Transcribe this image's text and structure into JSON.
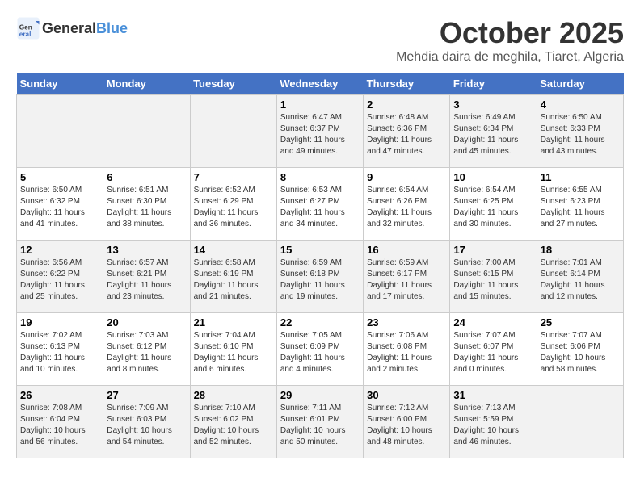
{
  "header": {
    "logo_general": "General",
    "logo_blue": "Blue",
    "month": "October 2025",
    "location": "Mehdia daira de meghila, Tiaret, Algeria"
  },
  "weekdays": [
    "Sunday",
    "Monday",
    "Tuesday",
    "Wednesday",
    "Thursday",
    "Friday",
    "Saturday"
  ],
  "weeks": [
    [
      {
        "day": "",
        "info": ""
      },
      {
        "day": "",
        "info": ""
      },
      {
        "day": "",
        "info": ""
      },
      {
        "day": "1",
        "info": "Sunrise: 6:47 AM\nSunset: 6:37 PM\nDaylight: 11 hours and 49 minutes."
      },
      {
        "day": "2",
        "info": "Sunrise: 6:48 AM\nSunset: 6:36 PM\nDaylight: 11 hours and 47 minutes."
      },
      {
        "day": "3",
        "info": "Sunrise: 6:49 AM\nSunset: 6:34 PM\nDaylight: 11 hours and 45 minutes."
      },
      {
        "day": "4",
        "info": "Sunrise: 6:50 AM\nSunset: 6:33 PM\nDaylight: 11 hours and 43 minutes."
      }
    ],
    [
      {
        "day": "5",
        "info": "Sunrise: 6:50 AM\nSunset: 6:32 PM\nDaylight: 11 hours and 41 minutes."
      },
      {
        "day": "6",
        "info": "Sunrise: 6:51 AM\nSunset: 6:30 PM\nDaylight: 11 hours and 38 minutes."
      },
      {
        "day": "7",
        "info": "Sunrise: 6:52 AM\nSunset: 6:29 PM\nDaylight: 11 hours and 36 minutes."
      },
      {
        "day": "8",
        "info": "Sunrise: 6:53 AM\nSunset: 6:27 PM\nDaylight: 11 hours and 34 minutes."
      },
      {
        "day": "9",
        "info": "Sunrise: 6:54 AM\nSunset: 6:26 PM\nDaylight: 11 hours and 32 minutes."
      },
      {
        "day": "10",
        "info": "Sunrise: 6:54 AM\nSunset: 6:25 PM\nDaylight: 11 hours and 30 minutes."
      },
      {
        "day": "11",
        "info": "Sunrise: 6:55 AM\nSunset: 6:23 PM\nDaylight: 11 hours and 27 minutes."
      }
    ],
    [
      {
        "day": "12",
        "info": "Sunrise: 6:56 AM\nSunset: 6:22 PM\nDaylight: 11 hours and 25 minutes."
      },
      {
        "day": "13",
        "info": "Sunrise: 6:57 AM\nSunset: 6:21 PM\nDaylight: 11 hours and 23 minutes."
      },
      {
        "day": "14",
        "info": "Sunrise: 6:58 AM\nSunset: 6:19 PM\nDaylight: 11 hours and 21 minutes."
      },
      {
        "day": "15",
        "info": "Sunrise: 6:59 AM\nSunset: 6:18 PM\nDaylight: 11 hours and 19 minutes."
      },
      {
        "day": "16",
        "info": "Sunrise: 6:59 AM\nSunset: 6:17 PM\nDaylight: 11 hours and 17 minutes."
      },
      {
        "day": "17",
        "info": "Sunrise: 7:00 AM\nSunset: 6:15 PM\nDaylight: 11 hours and 15 minutes."
      },
      {
        "day": "18",
        "info": "Sunrise: 7:01 AM\nSunset: 6:14 PM\nDaylight: 11 hours and 12 minutes."
      }
    ],
    [
      {
        "day": "19",
        "info": "Sunrise: 7:02 AM\nSunset: 6:13 PM\nDaylight: 11 hours and 10 minutes."
      },
      {
        "day": "20",
        "info": "Sunrise: 7:03 AM\nSunset: 6:12 PM\nDaylight: 11 hours and 8 minutes."
      },
      {
        "day": "21",
        "info": "Sunrise: 7:04 AM\nSunset: 6:10 PM\nDaylight: 11 hours and 6 minutes."
      },
      {
        "day": "22",
        "info": "Sunrise: 7:05 AM\nSunset: 6:09 PM\nDaylight: 11 hours and 4 minutes."
      },
      {
        "day": "23",
        "info": "Sunrise: 7:06 AM\nSunset: 6:08 PM\nDaylight: 11 hours and 2 minutes."
      },
      {
        "day": "24",
        "info": "Sunrise: 7:07 AM\nSunset: 6:07 PM\nDaylight: 11 hours and 0 minutes."
      },
      {
        "day": "25",
        "info": "Sunrise: 7:07 AM\nSunset: 6:06 PM\nDaylight: 10 hours and 58 minutes."
      }
    ],
    [
      {
        "day": "26",
        "info": "Sunrise: 7:08 AM\nSunset: 6:04 PM\nDaylight: 10 hours and 56 minutes."
      },
      {
        "day": "27",
        "info": "Sunrise: 7:09 AM\nSunset: 6:03 PM\nDaylight: 10 hours and 54 minutes."
      },
      {
        "day": "28",
        "info": "Sunrise: 7:10 AM\nSunset: 6:02 PM\nDaylight: 10 hours and 52 minutes."
      },
      {
        "day": "29",
        "info": "Sunrise: 7:11 AM\nSunset: 6:01 PM\nDaylight: 10 hours and 50 minutes."
      },
      {
        "day": "30",
        "info": "Sunrise: 7:12 AM\nSunset: 6:00 PM\nDaylight: 10 hours and 48 minutes."
      },
      {
        "day": "31",
        "info": "Sunrise: 7:13 AM\nSunset: 5:59 PM\nDaylight: 10 hours and 46 minutes."
      },
      {
        "day": "",
        "info": ""
      }
    ]
  ]
}
